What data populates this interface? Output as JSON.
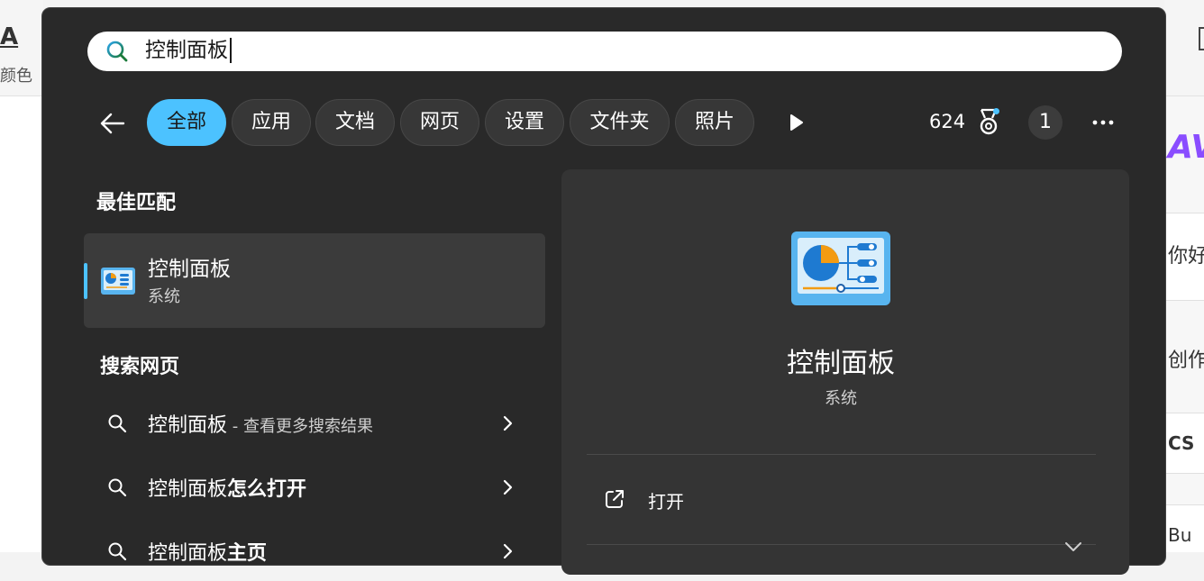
{
  "background": {
    "left_big_letter": "A",
    "left_label": "颜色",
    "right_texts": [
      "你好",
      "创作",
      "CS",
      "Bu"
    ],
    "right_logo_text": "AV"
  },
  "search": {
    "query": "控制面板"
  },
  "filters": {
    "chips": [
      {
        "label": "全部",
        "active": true
      },
      {
        "label": "应用",
        "active": false
      },
      {
        "label": "文档",
        "active": false
      },
      {
        "label": "网页",
        "active": false
      },
      {
        "label": "设置",
        "active": false
      },
      {
        "label": "文件夹",
        "active": false
      },
      {
        "label": "照片",
        "active": false
      }
    ],
    "points": "624",
    "avatar_initial": "1",
    "accent_color": "#4cc2ff"
  },
  "best_match": {
    "section_label": "最佳匹配",
    "title": "控制面板",
    "subtitle": "系统",
    "icon": "control-panel-icon"
  },
  "web_search": {
    "section_label": "搜索网页",
    "items": [
      {
        "prefix": "控制面板",
        "bold": "",
        "suffix": " - 查看更多搜索结果"
      },
      {
        "prefix": "控制面板",
        "bold": "怎么打开",
        "suffix": ""
      },
      {
        "prefix": "控制面板",
        "bold": "主页",
        "suffix": ""
      }
    ]
  },
  "detail": {
    "title": "控制面板",
    "subtitle": "系统",
    "actions": [
      {
        "label": "打开",
        "icon": "open-external-icon"
      }
    ]
  }
}
